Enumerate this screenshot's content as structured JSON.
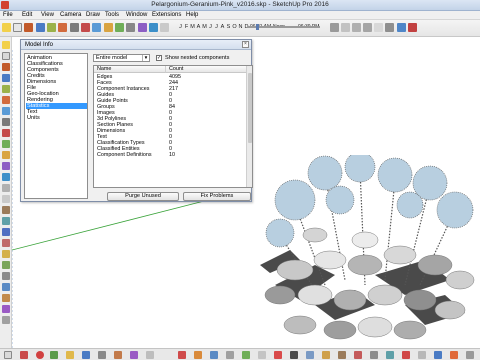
{
  "window": {
    "title": "Pelargonium-Geranium-Pink_v2016.skp - SketchUp Pro 2016"
  },
  "menu": {
    "items": [
      "File",
      "Edit",
      "View",
      "Camera",
      "Draw",
      "Tools",
      "Window",
      "Extensions",
      "Help"
    ]
  },
  "toolbar": {
    "months": [
      "J",
      "F",
      "M",
      "A",
      "M",
      "J",
      "J",
      "A",
      "S",
      "O",
      "N",
      "D"
    ],
    "time_start": "06:21 AM",
    "time_mid": "Noon",
    "time_end": "06:39 PM"
  },
  "dialog": {
    "title": "Model Info",
    "close_glyph": "×",
    "categories": [
      {
        "label": "Animation",
        "selected": false
      },
      {
        "label": "Classifications",
        "selected": false
      },
      {
        "label": "Components",
        "selected": false
      },
      {
        "label": "Credits",
        "selected": false
      },
      {
        "label": "Dimensions",
        "selected": false
      },
      {
        "label": "File",
        "selected": false
      },
      {
        "label": "Geo-location",
        "selected": false
      },
      {
        "label": "Rendering",
        "selected": false
      },
      {
        "label": "Statistics",
        "selected": true
      },
      {
        "label": "Text",
        "selected": false
      },
      {
        "label": "Units",
        "selected": false
      }
    ],
    "filter": {
      "value": "Entire model"
    },
    "show_nested": {
      "label": "Show nested components",
      "checked": true,
      "glyph": "✓"
    },
    "table": {
      "columns": [
        "Name",
        "Count"
      ],
      "rows": [
        {
          "name": "Edges",
          "count": "4095"
        },
        {
          "name": "Faces",
          "count": "244"
        },
        {
          "name": "Component Instances",
          "count": "217"
        },
        {
          "name": "Guides",
          "count": "0"
        },
        {
          "name": "Guide Points",
          "count": "0"
        },
        {
          "name": "Groups",
          "count": "84"
        },
        {
          "name": "Images",
          "count": "0"
        },
        {
          "name": "3d Polylines",
          "count": "0"
        },
        {
          "name": "Section Planes",
          "count": "0"
        },
        {
          "name": "Dimensions",
          "count": "0"
        },
        {
          "name": "Text",
          "count": "0"
        },
        {
          "name": "Classification Types",
          "count": "0"
        },
        {
          "name": "Classified Entities",
          "count": "0"
        },
        {
          "name": "Component Definitions",
          "count": "10"
        }
      ]
    },
    "buttons": {
      "purge": "Purge Unused",
      "fix": "Fix Problems"
    }
  },
  "colors": {
    "selection": "#3399ff",
    "axis_green": "#3aa33a",
    "leaf_blue": "#b8cfe0",
    "leaf_gray": "#9a9a9a"
  }
}
